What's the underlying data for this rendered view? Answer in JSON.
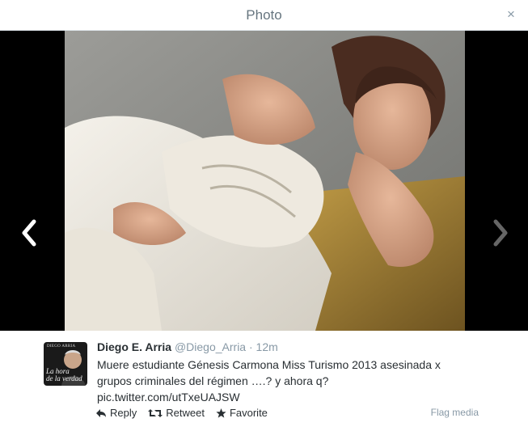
{
  "header": {
    "title": "Photo",
    "close_glyph": "×"
  },
  "nav": {
    "prev_icon": "chevron-left-icon",
    "next_icon": "chevron-right-icon"
  },
  "tweet": {
    "avatar_brand": "DIEGO ARRIA",
    "avatar_caption_1": "La hora",
    "avatar_caption_2": "de la verdad",
    "fullname": "Diego E. Arria",
    "username": "@Diego_Arria",
    "separator": "·",
    "time": "12m",
    "text_line_1": "Muere estudiante Génesis Carmona Miss Turismo 2013 asesinada x",
    "text_line_2": "grupos criminales del régimen ….? y ahora q?",
    "text_line_3": "pic.twitter.com/utTxeUAJSW"
  },
  "actions": {
    "reply_label": "Reply",
    "retweet_label": "Retweet",
    "favorite_label": "Favorite",
    "flag_label": "Flag media"
  },
  "colors": {
    "link": "#292f33",
    "muted": "#8899a6",
    "stage_bg": "#000000"
  }
}
